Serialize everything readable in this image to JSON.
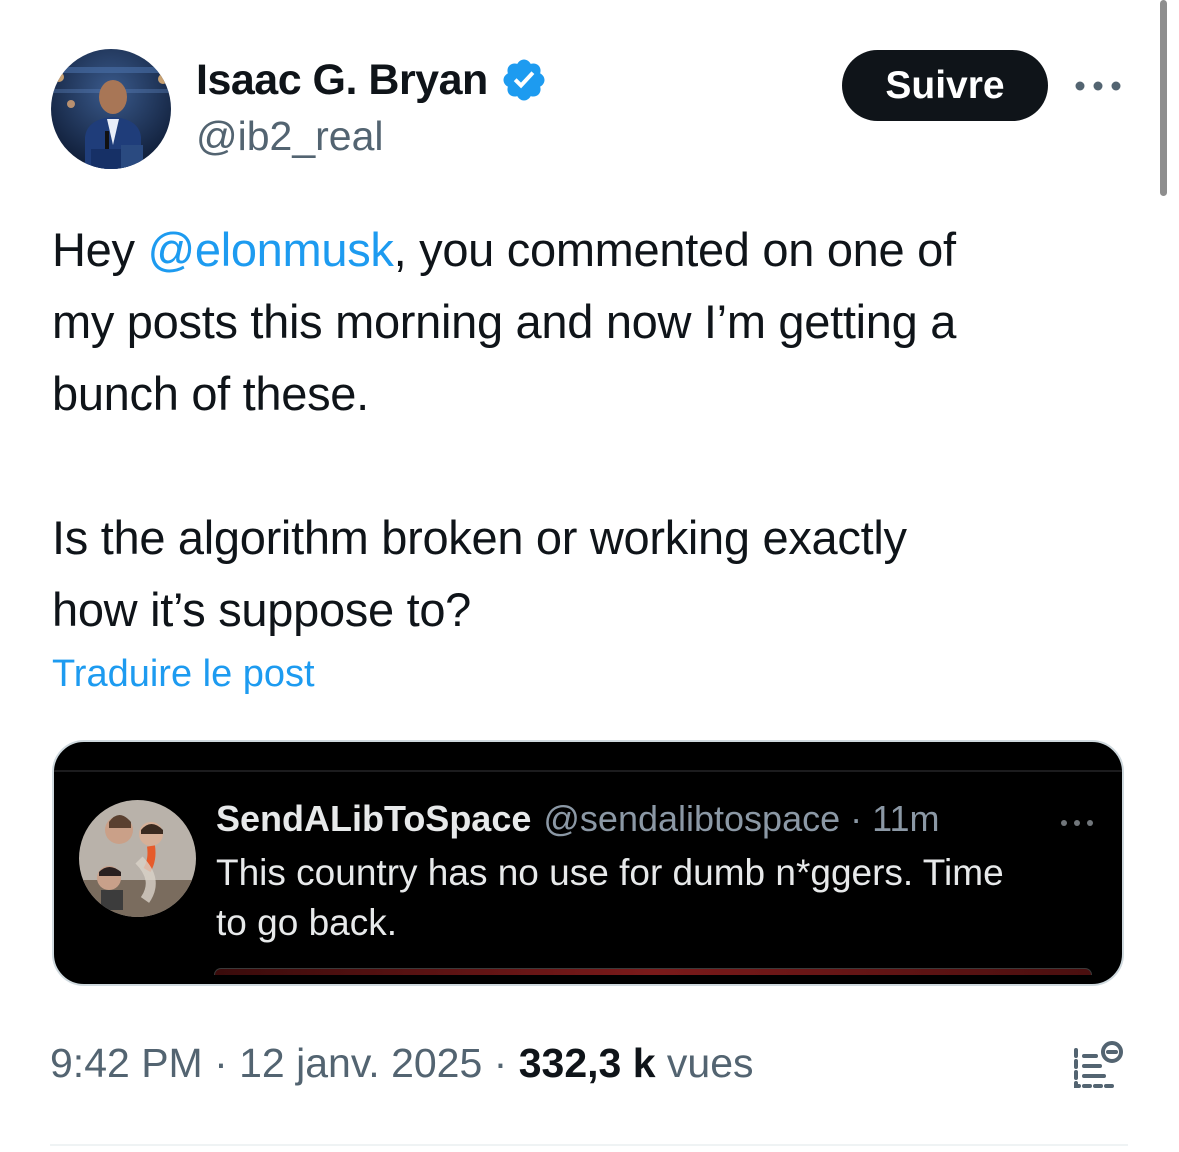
{
  "author": {
    "display_name": "Isaac G. Bryan",
    "handle": "@ib2_real",
    "verified": true
  },
  "actions": {
    "follow_label": "Suivre",
    "more_icon": "more-horizontal-icon"
  },
  "tweet": {
    "line1_prefix": "Hey ",
    "mention": "@elonmusk",
    "line1_suffix": ", you commented on one of",
    "line2": "my posts this morning and now I’m getting a",
    "line3": "bunch of these.",
    "line4": "Is the algorithm broken or working exactly",
    "line5": "how it’s suppose to?",
    "translate_link": "Traduire le post"
  },
  "quoted_screenshot": {
    "display_name": "SendALibToSpace",
    "meta": "@sendalibtospace · 11m",
    "line1": "This country has no use for dumb n*ggers. Time",
    "line2": "to go back."
  },
  "footer": {
    "time_date": "9:42 PM · 12 janv. 2025 · ",
    "views_count": "332,3 k",
    "views_label": " vues",
    "analytics_icon": "view-analytics-icon"
  },
  "colors": {
    "accent": "#1d9bf0",
    "text": "#0f1419",
    "secondary": "#536471",
    "follow_bg": "#0f1419"
  }
}
